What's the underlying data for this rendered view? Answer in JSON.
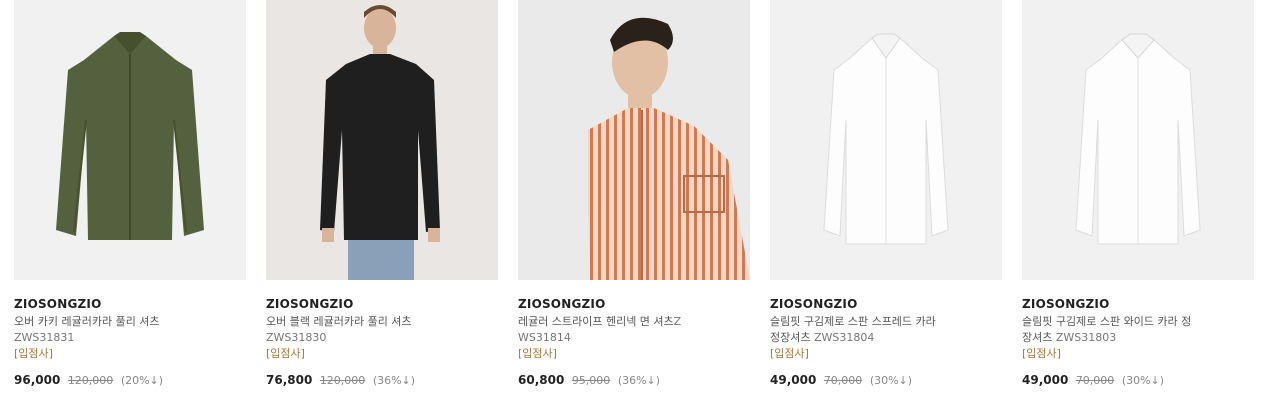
{
  "products": [
    {
      "brand": "ZIOSONGZIO",
      "name": "오버 카키 레귤러카라 풀리 셔츠",
      "code": "ZWS31831",
      "vendor": "[입점사]",
      "price": "96,000",
      "original_price": "120,000",
      "discount": "(20%↓)",
      "image": "khaki-shirt-flat"
    },
    {
      "brand": "ZIOSONGZIO",
      "name": "오버 블랙 레귤러카라 풀리 셔츠",
      "code": "ZWS31830",
      "vendor": "[입점사]",
      "price": "76,800",
      "original_price": "120,000",
      "discount": "(36%↓)",
      "image": "model-black-shirt"
    },
    {
      "brand": "ZIOSONGZIO",
      "name": "레귤러 스트라이프 헨리넥 면 셔츠",
      "code": "ZWS31814",
      "vendor": "[입점사]",
      "price": "60,800",
      "original_price": "95,000",
      "discount": "(36%↓)",
      "image": "model-striped-shirt"
    },
    {
      "brand": "ZIOSONGZIO",
      "name": "슬림핏 구김제로 스판 스프레드 카라 정장셔츠",
      "code": "ZWS31804",
      "vendor": "[입점사]",
      "price": "49,000",
      "original_price": "70,000",
      "discount": "(30%↓)",
      "image": "white-dress-shirt"
    },
    {
      "brand": "ZIOSONGZIO",
      "name": "슬림핏 구김제로 스판 와이드 카라 정장셔츠",
      "code": "ZWS31803",
      "vendor": "[입점사]",
      "price": "49,000",
      "original_price": "70,000",
      "discount": "(30%↓)",
      "image": "white-dress-shirt"
    }
  ]
}
